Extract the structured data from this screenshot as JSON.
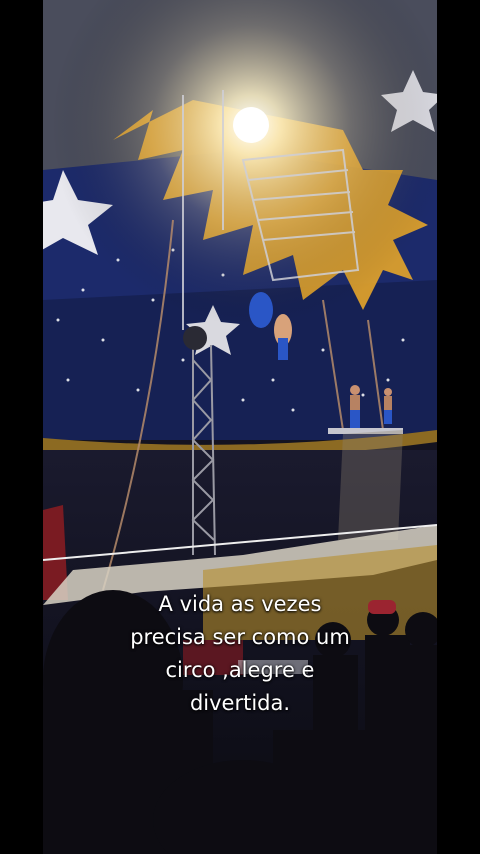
{
  "caption": {
    "lines": [
      "A vida as vezes",
      "precisa ser como um",
      "circo ,alegre e",
      "divertida."
    ]
  },
  "colors": {
    "letterbox": "#000000",
    "tent_blue": "#1c2a6b",
    "tent_yellow": "#e6a52a",
    "caption_text": "#ffffff"
  }
}
